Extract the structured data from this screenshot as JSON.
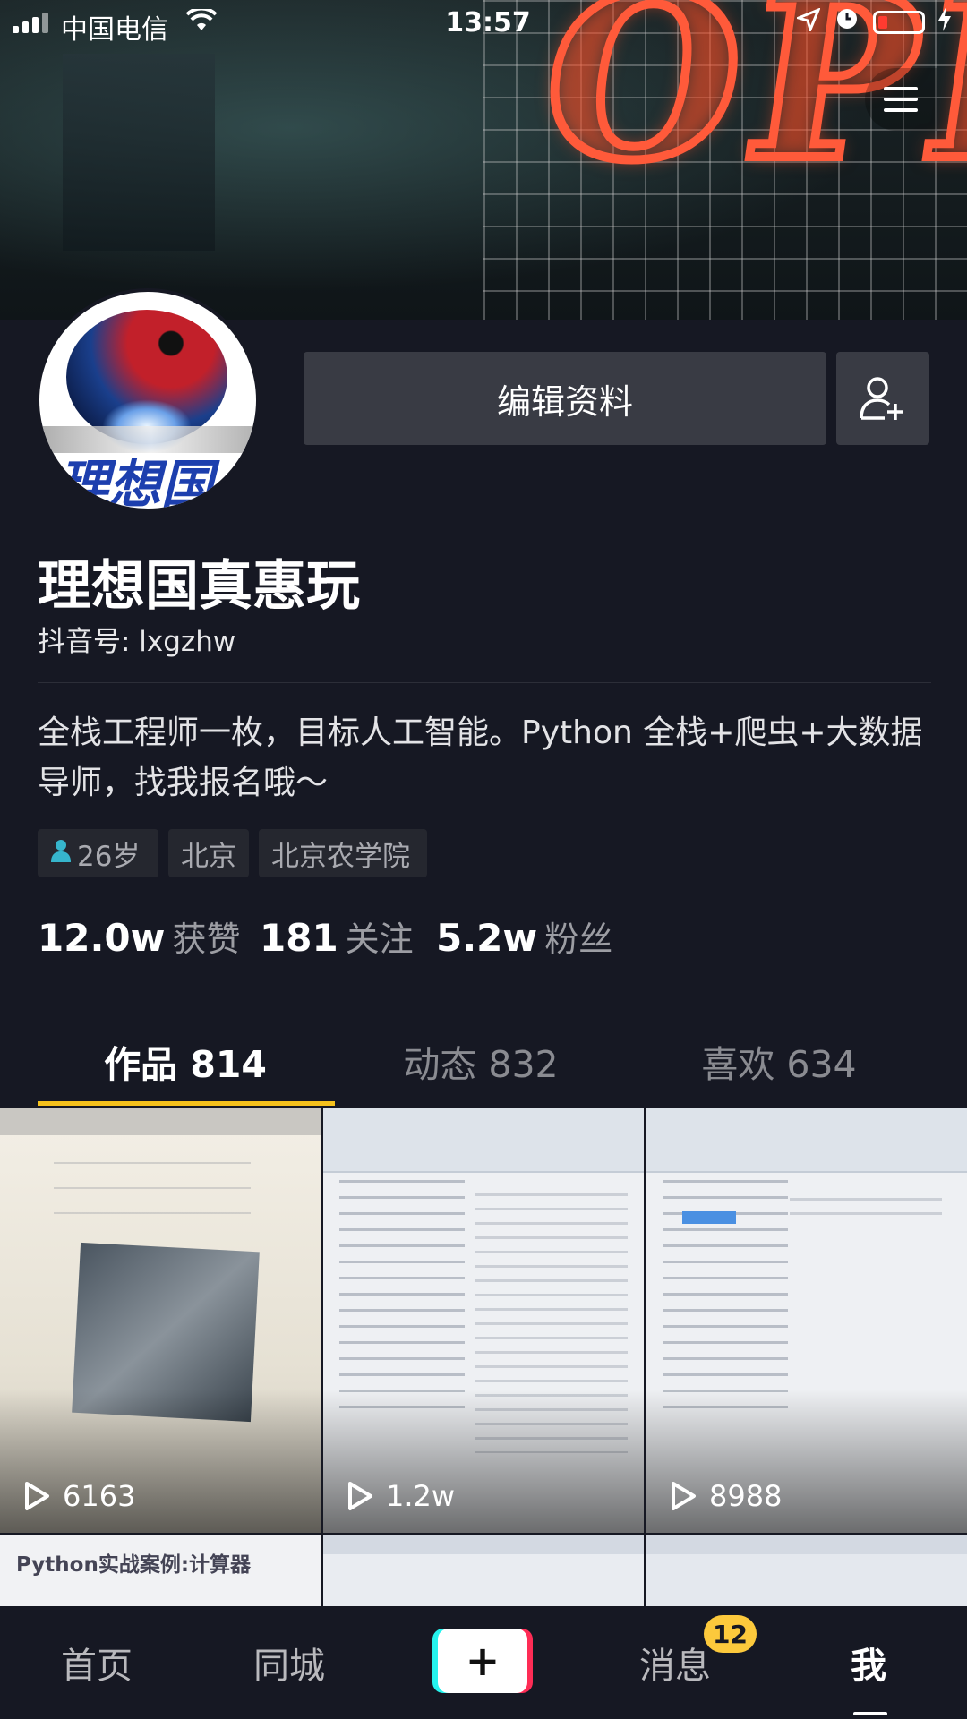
{
  "status_bar": {
    "carrier": "中国电信",
    "time": "13:57",
    "icons": [
      "signal-icon",
      "wifi-icon",
      "location-icon",
      "alarm-icon",
      "battery-low-icon",
      "charging-icon"
    ]
  },
  "header": {
    "menu_icon": "hamburger-menu-icon"
  },
  "profile": {
    "avatar_text": "理想国",
    "edit_button": "编辑资料",
    "add_friend_icon": "add-friend-icon",
    "username": "理想国真惠玩",
    "douyin_id": "抖音号: lxgzhw",
    "bio": "全栈工程师一枚，目标人工智能。Python 全栈+爬虫+大数据导师，找我报名哦～",
    "tags": {
      "age": "26岁",
      "city": "北京",
      "school": "北京农学院"
    },
    "stats": {
      "likes_num": "12.0w",
      "likes_label": "获赞",
      "following_num": "181",
      "following_label": "关注",
      "fans_num": "5.2w",
      "fans_label": "粉丝"
    }
  },
  "tabs": {
    "works": "作品 814",
    "dynamics": "动态 832",
    "likes": "喜欢 634",
    "active": "works"
  },
  "videos": [
    {
      "plays": "6163"
    },
    {
      "plays": "1.2w"
    },
    {
      "plays": "8988"
    },
    {
      "title": "Python实战案例:计算器"
    },
    {},
    {}
  ],
  "bottom_nav": {
    "home": "首页",
    "city": "同城",
    "messages": "消息",
    "messages_badge": "12",
    "me": "我"
  },
  "colors": {
    "background": "#161823",
    "button": "#393b44",
    "tab_indicator": "#f5c11c",
    "badge": "#fcc93c",
    "plus_cyan": "#25f4ee",
    "plus_red": "#fe2c55"
  }
}
